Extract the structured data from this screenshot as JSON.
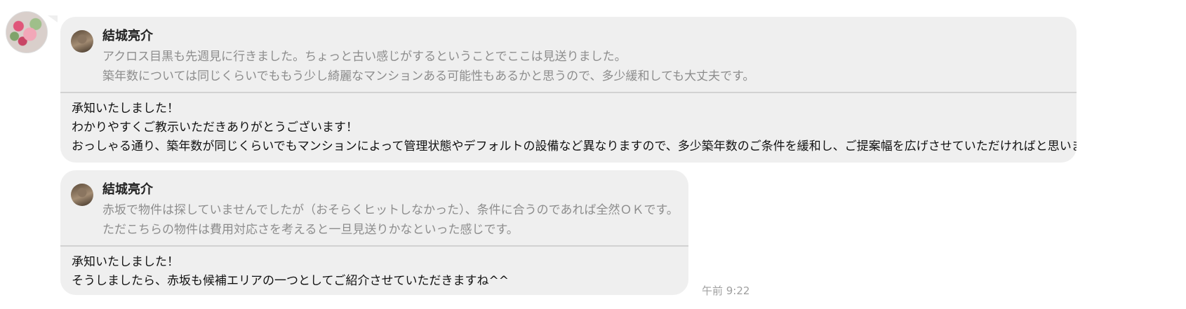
{
  "messages": [
    {
      "quote": {
        "sender": "結城亮介",
        "lines": [
          "アクロス目黒も先週見に行きました。ちょっと古い感じがするということでここは見送りました。",
          "築年数については同じくらいでももう少し綺麗なマンションある可能性もあるかと思うので、多少緩和しても大丈夫です。"
        ]
      },
      "reply": [
        "承知いたしました！",
        "わかりやすくご教示いただきありがとうございます！",
        "おっしゃる通り、築年数が同じくらいでもマンションによって管理状態やデフォルトの設備など異なりますので、多少築年数のご条件を緩和し、ご提案幅を広げさせていただければと思います。"
      ]
    },
    {
      "quote": {
        "sender": "結城亮介",
        "lines": [
          "赤坂で物件は探していませんでしたが（おそらくヒットしなかった）、条件に合うのであれば全然ＯＫです。",
          "ただこちらの物件は費用対応さを考えると一旦見送りかなといった感じです。"
        ]
      },
      "reply": [
        "承知いたしました！",
        "そうしましたら、赤坂も候補エリアの一つとしてご紹介させていただきますね^^"
      ]
    }
  ],
  "timestamp": "午前 9:22"
}
